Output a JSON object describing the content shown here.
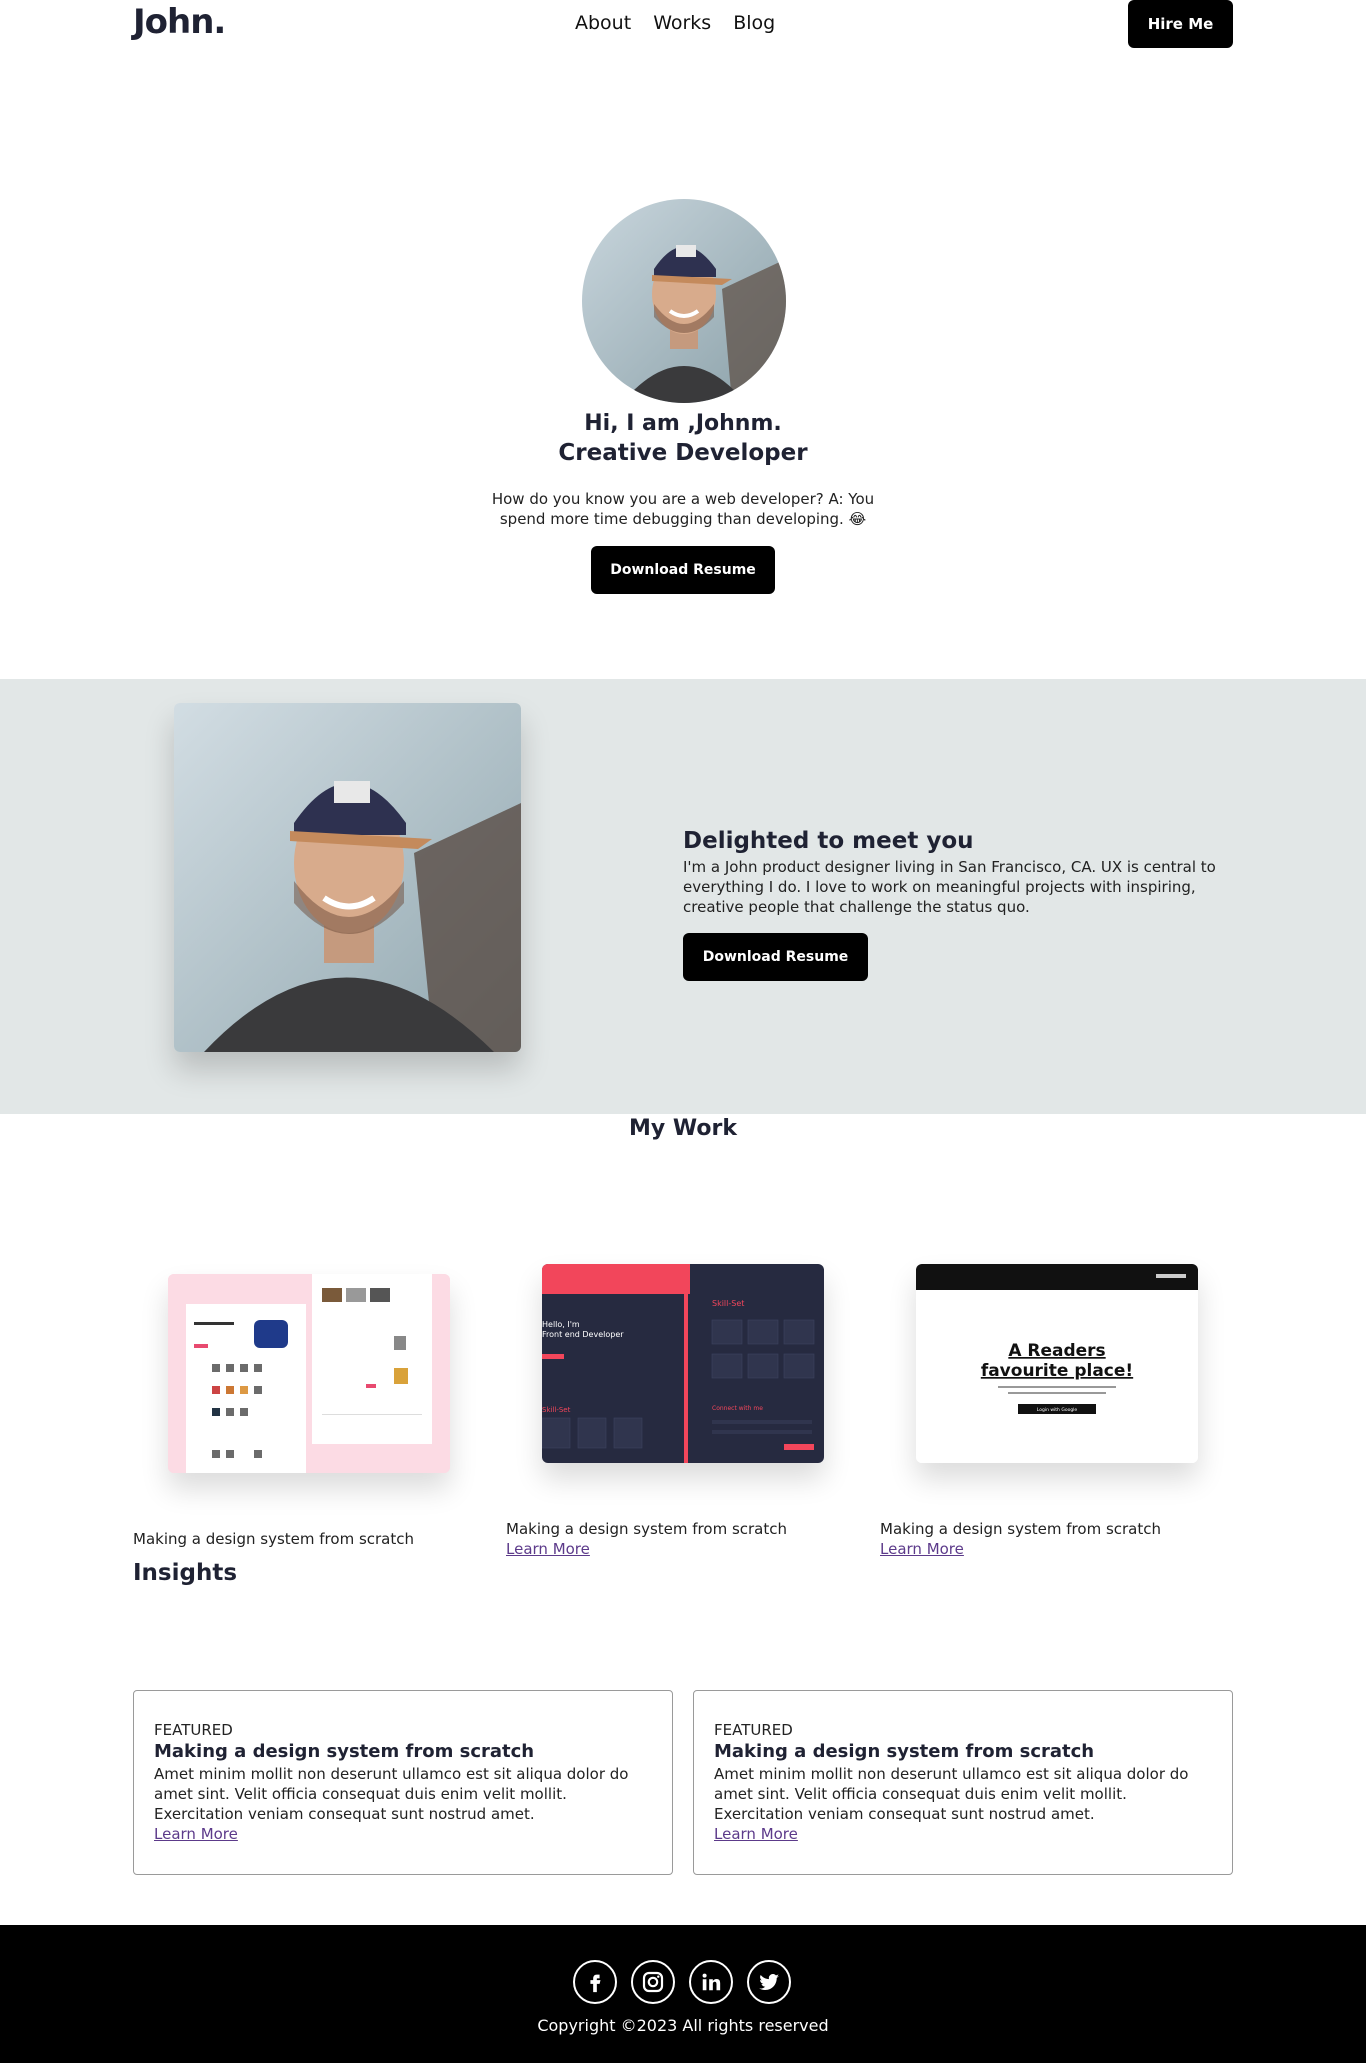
{
  "header": {
    "logo": "John.",
    "nav": [
      "About",
      "Works",
      "Blog"
    ],
    "hire_label": "Hire Me"
  },
  "hero": {
    "greeting": "Hi, I am ,Johnm.",
    "role": "Creative Developer",
    "description": "How do you know you are a web developer? A: You spend more time debugging than developing. 😂",
    "button_label": "Download Resume"
  },
  "about": {
    "title": "Delighted to meet you",
    "text": "I'm a John product designer living in San Francisco, CA. UX is central to everything I do. I love to work on meaningful projects with inspiring, creative people that challenge the status quo.",
    "button_label": "Download Resume"
  },
  "works": {
    "heading": "My Work",
    "items": [
      {
        "caption": "Making a design system from scratch",
        "link": ""
      },
      {
        "caption": "Making a design system from scratch",
        "link": "Learn More"
      },
      {
        "caption": "Making a design system from scratch",
        "link": "Learn More"
      }
    ],
    "thumb2": {
      "hello": "Hello, I'm",
      "role": "Front end Developer",
      "skill": "Skill-Set",
      "connect": "Connect with me"
    },
    "thumb3": {
      "headline_1": "A Readers",
      "headline_2": "favourite place!",
      "button": "Login with Google"
    }
  },
  "insights": {
    "heading": "Insights",
    "cards": [
      {
        "tag": "FEATURED",
        "title": "Making a design system from scratch",
        "text": "Amet minim mollit non deserunt ullamco est sit aliqua dolor do amet sint. Velit officia consequat duis enim velit mollit. Exercitation veniam consequat sunt nostrud amet.",
        "link": "Learn More"
      },
      {
        "tag": "FEATURED",
        "title": "Making a design system from scratch",
        "text": "Amet minim mollit non deserunt ullamco est sit aliqua dolor do amet sint. Velit officia consequat duis enim velit mollit. Exercitation veniam consequat sunt nostrud amet.",
        "link": "Learn More"
      }
    ]
  },
  "footer": {
    "socials": [
      "facebook-icon",
      "instagram-icon",
      "linkedin-icon",
      "twitter-icon"
    ],
    "copyright": "Copyright ©2023 All rights reserved"
  }
}
